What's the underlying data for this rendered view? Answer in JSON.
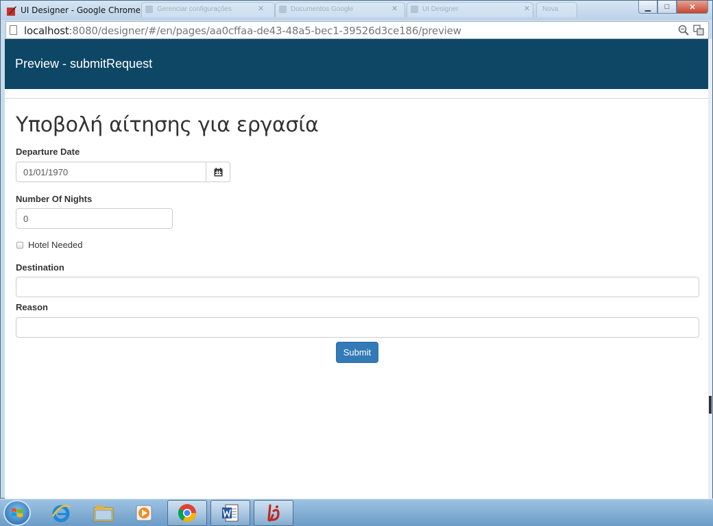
{
  "window": {
    "title": "UI Designer - Google Chrome",
    "background_tabs": [
      "Gerenciar configurações",
      "Documentos Google",
      "UI Designer",
      "Nova"
    ],
    "buttons": {
      "minimize": "▁",
      "maximize": "□",
      "close": "✕"
    }
  },
  "address_bar": {
    "host": "localhost",
    "rest": ":8080/designer/#/en/pages/aa0cffaa-de43-48a5-bec1-39526d3ce186/preview",
    "icons": [
      "zoom-icon",
      "translate-icon"
    ]
  },
  "preview_header": {
    "title": "Preview - submitRequest",
    "color": "#0e4766"
  },
  "form": {
    "title": "Υποβολή αίτησης για εργασία",
    "departure_date": {
      "label": "Departure Date",
      "value": "01/01/1970"
    },
    "number_of_nights": {
      "label": "Number Of Nights",
      "value": "0"
    },
    "hotel_needed": {
      "label": "Hotel Needed",
      "checked": false
    },
    "destination": {
      "label": "Destination",
      "value": ""
    },
    "reason": {
      "label": "Reason",
      "value": ""
    },
    "submit_label": "Submit",
    "submit_color": "#337ab7"
  },
  "taskbar": {
    "items": [
      "internet-explorer-icon",
      "file-explorer-icon",
      "media-player-icon",
      "chrome-icon",
      "word-icon",
      "bonita-icon"
    ],
    "active": "chrome-icon"
  }
}
